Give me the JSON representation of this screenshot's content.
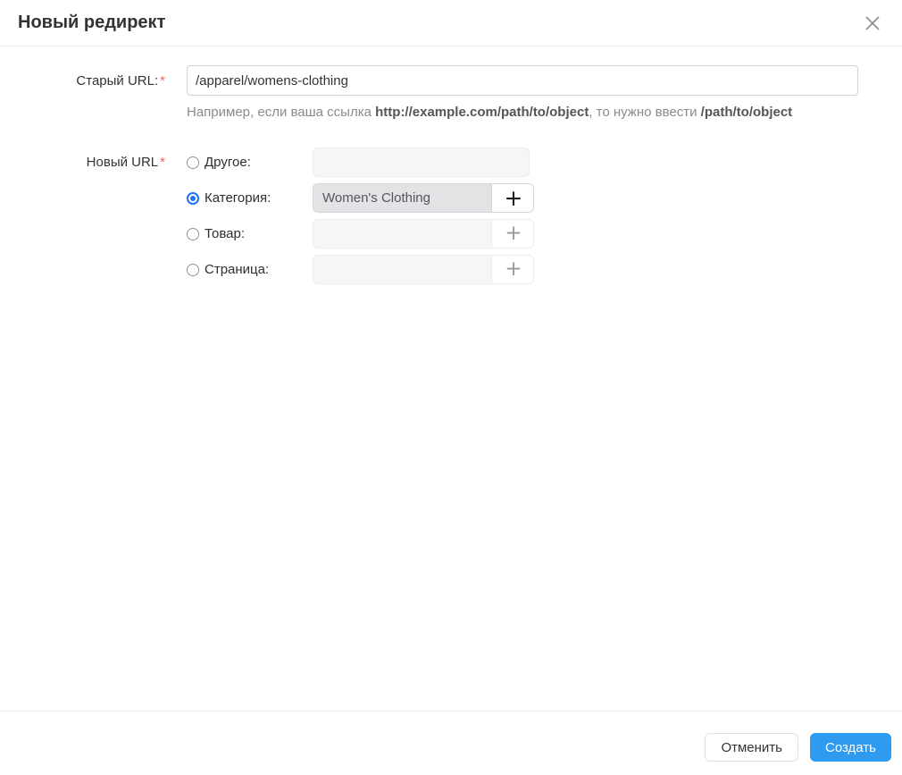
{
  "modal": {
    "title": "Новый редирект"
  },
  "form": {
    "old_url": {
      "label": "Старый URL:",
      "required_mark": "*",
      "value": "/apparel/womens-clothing",
      "hint": {
        "part1": "Например, если ваша ссылка ",
        "bold1": "http://example.com/path/to/object",
        "part2": ", то нужно ввести ",
        "bold2": "/path/to/object"
      }
    },
    "new_url": {
      "label": "Новый URL",
      "required_mark": "*",
      "add_button_glyph": "+",
      "options": [
        {
          "label": "Другое:",
          "checked": false,
          "value": "",
          "has_add_button": false
        },
        {
          "label": "Категория:",
          "checked": true,
          "value": "Women's Clothing",
          "has_add_button": true
        },
        {
          "label": "Товар:",
          "checked": false,
          "value": "",
          "has_add_button": true
        },
        {
          "label": "Страница:",
          "checked": false,
          "value": "",
          "has_add_button": true
        }
      ]
    }
  },
  "footer": {
    "cancel_label": "Отменить",
    "create_label": "Создать"
  },
  "colors": {
    "accent_blue": "#2f9bf0",
    "radio_blue": "#2172f5",
    "required_red": "#f4645f"
  }
}
